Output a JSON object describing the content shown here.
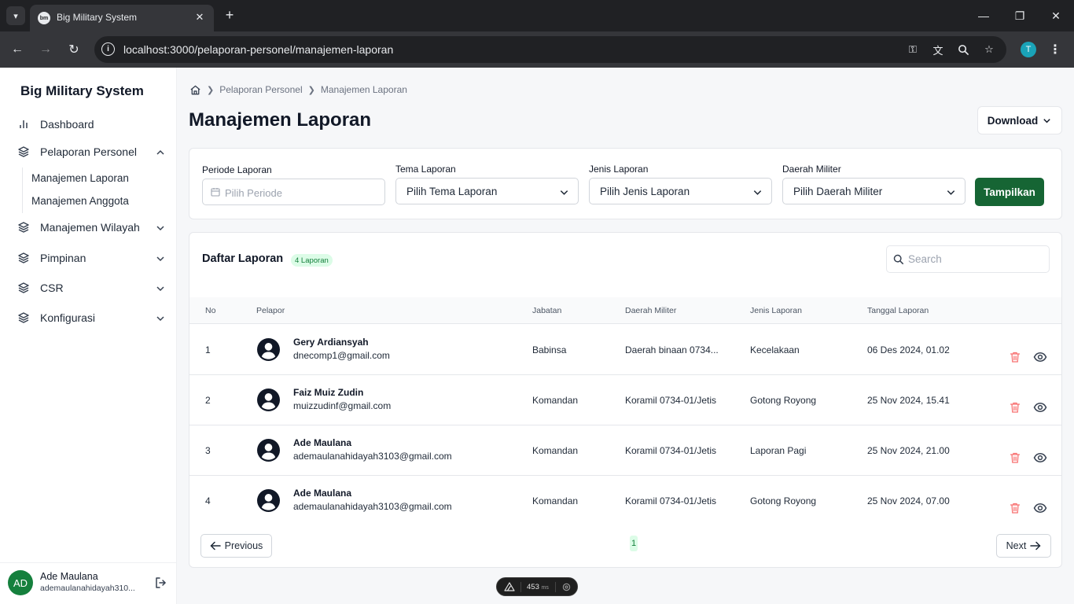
{
  "browser": {
    "tab_title": "Big Military System",
    "tab_favicon": "bm",
    "url": "localhost:3000/pelaporan-personel/manajemen-laporan",
    "profile_initial": "T"
  },
  "sidebar": {
    "brand": "Big Military System",
    "items": [
      {
        "label": "Dashboard",
        "icon": "bar-chart-icon"
      },
      {
        "label": "Pelaporan Personel",
        "icon": "layers-icon",
        "expanded": true
      },
      {
        "label": "Manajemen Wilayah",
        "icon": "layers-icon"
      },
      {
        "label": "Pimpinan",
        "icon": "layers-icon"
      },
      {
        "label": "CSR",
        "icon": "layers-icon"
      },
      {
        "label": "Konfigurasi",
        "icon": "layers-icon"
      }
    ],
    "submenu": [
      {
        "label": "Manajemen Laporan"
      },
      {
        "label": "Manajemen Anggota"
      }
    ],
    "user": {
      "initials": "AD",
      "name": "Ade Maulana",
      "email": "ademaulanahidayah310..."
    }
  },
  "breadcrumb": [
    "Pelaporan Personel",
    "Manajemen Laporan"
  ],
  "page_title": "Manajemen Laporan",
  "download_label": "Download",
  "filters": {
    "periode": {
      "label": "Periode Laporan",
      "placeholder": "Pilih Periode"
    },
    "tema": {
      "label": "Tema Laporan",
      "value": "Pilih Tema Laporan"
    },
    "jenis": {
      "label": "Jenis Laporan",
      "value": "Pilih Jenis Laporan"
    },
    "daerah": {
      "label": "Daerah Militer",
      "value": "Pilih Daerah Militer"
    },
    "submit_label": "Tampilkan"
  },
  "list": {
    "title": "Daftar Laporan",
    "badge": "4 Laporan",
    "search_placeholder": "Search",
    "columns": [
      "No",
      "Pelapor",
      "Jabatan",
      "Daerah Militer",
      "Jenis Laporan",
      "Tanggal Laporan"
    ],
    "rows": [
      {
        "no": "1",
        "name": "Gery Ardiansyah",
        "email": "dnecomp1@gmail.com",
        "jabatan": "Babinsa",
        "daerah": "Daerah binaan 0734...",
        "jenis": "Kecelakaan",
        "tanggal": "06 Des 2024, 01.02"
      },
      {
        "no": "2",
        "name": "Faiz Muiz Zudin",
        "email": "muizzudinf@gmail.com",
        "jabatan": "Komandan",
        "daerah": "Koramil 0734-01/Jetis",
        "jenis": "Gotong Royong",
        "tanggal": "25 Nov 2024, 15.41"
      },
      {
        "no": "3",
        "name": "Ade Maulana",
        "email": "ademaulanahidayah3103@gmail.com",
        "jabatan": "Komandan",
        "daerah": "Koramil 0734-01/Jetis",
        "jenis": "Laporan Pagi",
        "tanggal": "25 Nov 2024, 21.00"
      },
      {
        "no": "4",
        "name": "Ade Maulana",
        "email": "ademaulanahidayah3103@gmail.com",
        "jabatan": "Komandan",
        "daerah": "Koramil 0734-01/Jetis",
        "jenis": "Gotong Royong",
        "tanggal": "25 Nov 2024, 07.00"
      }
    ],
    "pagination": {
      "previous": "Previous",
      "next": "Next",
      "current_page": "1"
    }
  },
  "dev_indicator": {
    "time": "453",
    "unit": "ms"
  },
  "colors": {
    "primary": "#166534",
    "badge_bg": "#dcfce7",
    "badge_text": "#15803d",
    "delete": "#f87171"
  }
}
